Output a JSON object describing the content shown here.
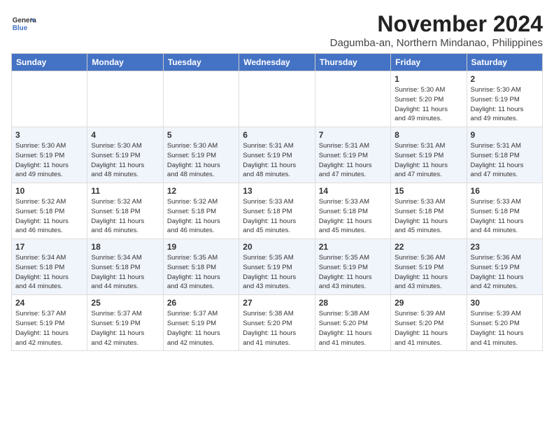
{
  "header": {
    "logo_line1": "General",
    "logo_line2": "Blue",
    "month_title": "November 2024",
    "subtitle": "Dagumba-an, Northern Mindanao, Philippines"
  },
  "weekdays": [
    "Sunday",
    "Monday",
    "Tuesday",
    "Wednesday",
    "Thursday",
    "Friday",
    "Saturday"
  ],
  "weeks": [
    [
      {
        "day": "",
        "info": ""
      },
      {
        "day": "",
        "info": ""
      },
      {
        "day": "",
        "info": ""
      },
      {
        "day": "",
        "info": ""
      },
      {
        "day": "",
        "info": ""
      },
      {
        "day": "1",
        "info": "Sunrise: 5:30 AM\nSunset: 5:20 PM\nDaylight: 11 hours\nand 49 minutes."
      },
      {
        "day": "2",
        "info": "Sunrise: 5:30 AM\nSunset: 5:19 PM\nDaylight: 11 hours\nand 49 minutes."
      }
    ],
    [
      {
        "day": "3",
        "info": "Sunrise: 5:30 AM\nSunset: 5:19 PM\nDaylight: 11 hours\nand 49 minutes."
      },
      {
        "day": "4",
        "info": "Sunrise: 5:30 AM\nSunset: 5:19 PM\nDaylight: 11 hours\nand 48 minutes."
      },
      {
        "day": "5",
        "info": "Sunrise: 5:30 AM\nSunset: 5:19 PM\nDaylight: 11 hours\nand 48 minutes."
      },
      {
        "day": "6",
        "info": "Sunrise: 5:31 AM\nSunset: 5:19 PM\nDaylight: 11 hours\nand 48 minutes."
      },
      {
        "day": "7",
        "info": "Sunrise: 5:31 AM\nSunset: 5:19 PM\nDaylight: 11 hours\nand 47 minutes."
      },
      {
        "day": "8",
        "info": "Sunrise: 5:31 AM\nSunset: 5:19 PM\nDaylight: 11 hours\nand 47 minutes."
      },
      {
        "day": "9",
        "info": "Sunrise: 5:31 AM\nSunset: 5:18 PM\nDaylight: 11 hours\nand 47 minutes."
      }
    ],
    [
      {
        "day": "10",
        "info": "Sunrise: 5:32 AM\nSunset: 5:18 PM\nDaylight: 11 hours\nand 46 minutes."
      },
      {
        "day": "11",
        "info": "Sunrise: 5:32 AM\nSunset: 5:18 PM\nDaylight: 11 hours\nand 46 minutes."
      },
      {
        "day": "12",
        "info": "Sunrise: 5:32 AM\nSunset: 5:18 PM\nDaylight: 11 hours\nand 46 minutes."
      },
      {
        "day": "13",
        "info": "Sunrise: 5:33 AM\nSunset: 5:18 PM\nDaylight: 11 hours\nand 45 minutes."
      },
      {
        "day": "14",
        "info": "Sunrise: 5:33 AM\nSunset: 5:18 PM\nDaylight: 11 hours\nand 45 minutes."
      },
      {
        "day": "15",
        "info": "Sunrise: 5:33 AM\nSunset: 5:18 PM\nDaylight: 11 hours\nand 45 minutes."
      },
      {
        "day": "16",
        "info": "Sunrise: 5:33 AM\nSunset: 5:18 PM\nDaylight: 11 hours\nand 44 minutes."
      }
    ],
    [
      {
        "day": "17",
        "info": "Sunrise: 5:34 AM\nSunset: 5:18 PM\nDaylight: 11 hours\nand 44 minutes."
      },
      {
        "day": "18",
        "info": "Sunrise: 5:34 AM\nSunset: 5:18 PM\nDaylight: 11 hours\nand 44 minutes."
      },
      {
        "day": "19",
        "info": "Sunrise: 5:35 AM\nSunset: 5:18 PM\nDaylight: 11 hours\nand 43 minutes."
      },
      {
        "day": "20",
        "info": "Sunrise: 5:35 AM\nSunset: 5:19 PM\nDaylight: 11 hours\nand 43 minutes."
      },
      {
        "day": "21",
        "info": "Sunrise: 5:35 AM\nSunset: 5:19 PM\nDaylight: 11 hours\nand 43 minutes."
      },
      {
        "day": "22",
        "info": "Sunrise: 5:36 AM\nSunset: 5:19 PM\nDaylight: 11 hours\nand 43 minutes."
      },
      {
        "day": "23",
        "info": "Sunrise: 5:36 AM\nSunset: 5:19 PM\nDaylight: 11 hours\nand 42 minutes."
      }
    ],
    [
      {
        "day": "24",
        "info": "Sunrise: 5:37 AM\nSunset: 5:19 PM\nDaylight: 11 hours\nand 42 minutes."
      },
      {
        "day": "25",
        "info": "Sunrise: 5:37 AM\nSunset: 5:19 PM\nDaylight: 11 hours\nand 42 minutes."
      },
      {
        "day": "26",
        "info": "Sunrise: 5:37 AM\nSunset: 5:19 PM\nDaylight: 11 hours\nand 42 minutes."
      },
      {
        "day": "27",
        "info": "Sunrise: 5:38 AM\nSunset: 5:20 PM\nDaylight: 11 hours\nand 41 minutes."
      },
      {
        "day": "28",
        "info": "Sunrise: 5:38 AM\nSunset: 5:20 PM\nDaylight: 11 hours\nand 41 minutes."
      },
      {
        "day": "29",
        "info": "Sunrise: 5:39 AM\nSunset: 5:20 PM\nDaylight: 11 hours\nand 41 minutes."
      },
      {
        "day": "30",
        "info": "Sunrise: 5:39 AM\nSunset: 5:20 PM\nDaylight: 11 hours\nand 41 minutes."
      }
    ]
  ]
}
